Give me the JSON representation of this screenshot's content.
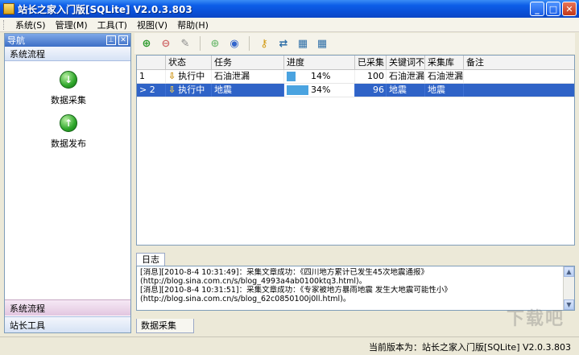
{
  "window": {
    "title": "站长之家入门版[SQLite] V2.0.3.803"
  },
  "menu": [
    "系统(S)",
    "管理(M)",
    "工具(T)",
    "视图(V)",
    "帮助(H)"
  ],
  "left_panel": {
    "header": "导航",
    "section": "系统流程",
    "tools": [
      "数据采集",
      "数据发布"
    ],
    "bottom_items": [
      "系统流程",
      "站长工具"
    ]
  },
  "grid": {
    "columns": [
      "",
      "状态",
      "任务",
      "进度",
      "已采集",
      "关键词不",
      "采集库",
      "备注"
    ],
    "rows": [
      {
        "index": "1",
        "status": "执行中",
        "task": "石油泄漏",
        "progress": "14%",
        "progress_value": 0.14,
        "collected": "100",
        "keyword": "石油泄漏",
        "library": "石油泄漏",
        "note": ""
      },
      {
        "index": "> 2",
        "status": "执行中",
        "task": "地震",
        "progress": "34%",
        "progress_value": 0.34,
        "collected": "96",
        "keyword": "地震",
        "library": "地震",
        "note": ""
      }
    ]
  },
  "log": {
    "tab_label": "日志",
    "lines": [
      "[消息][2010-8-4 10:31:49]：采集文章成功：《四川地方累计已发生45次地震通报》",
      "(http://blog.sina.com.cn/s/blog_4993a4ab0100ktq3.html)。",
      "[消息][2010-8-4 10:31:51]：采集文章成功：《专家被地方暴雨地震 发生大地震可能性小》",
      "(http://blog.sina.com.cn/s/blog_62c0850100j0ll.html)。"
    ]
  },
  "bottom_tab": "数据采集",
  "status": "当前版本为：站长之家入门版[SQLite] V2.0.3.803",
  "watermark": "下载吧"
}
